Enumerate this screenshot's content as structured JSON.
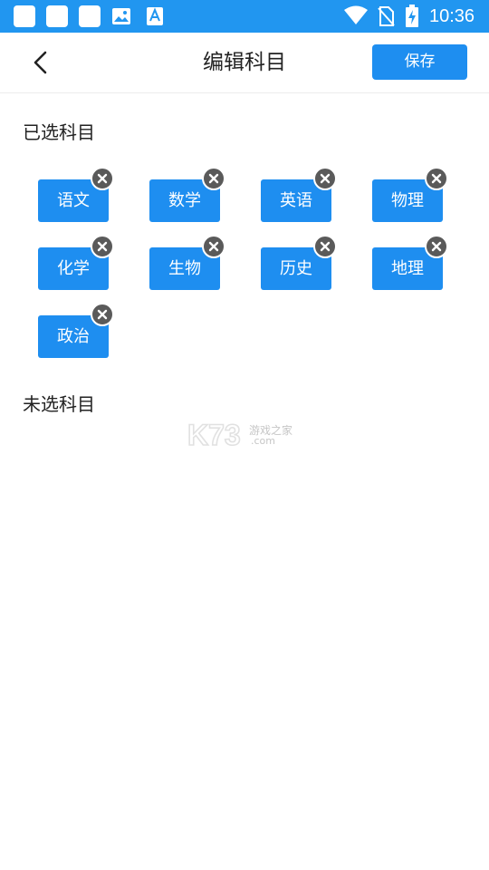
{
  "status_bar": {
    "time": "10:36",
    "bg_color": "#2196f0",
    "icons": [
      "notification-icon",
      "notification-icon",
      "notification-icon",
      "image-icon",
      "text-a-icon",
      "wifi-icon",
      "no-sim-icon",
      "battery-charging-icon"
    ]
  },
  "header": {
    "title": "编辑科目",
    "save_label": "保存",
    "back_icon": "chevron-left-icon"
  },
  "selected": {
    "title": "已选科目",
    "subjects": [
      "语文",
      "数学",
      "英语",
      "物理",
      "化学",
      "生物",
      "历史",
      "地理",
      "政治"
    ]
  },
  "unselected": {
    "title": "未选科目",
    "subjects": []
  },
  "watermark": {
    "logo": "K73",
    "text": "游戏之家",
    "domain": ".com"
  },
  "colors": {
    "accent": "#1e8ef0",
    "remove_badge": "#5a5a5a"
  }
}
